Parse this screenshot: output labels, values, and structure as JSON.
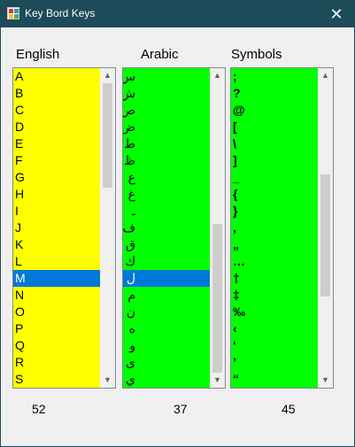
{
  "window": {
    "title": "Key Bord Keys",
    "close_glyph": "✕"
  },
  "english": {
    "header": "English",
    "items": [
      "A",
      "B",
      "C",
      "D",
      "E",
      "F",
      "G",
      "H",
      "I",
      "J",
      "K",
      "L",
      "M",
      "N",
      "O",
      "P",
      "Q",
      "R",
      "S"
    ],
    "selected": "M",
    "count": "52",
    "background": "#ffff00"
  },
  "arabic": {
    "header": "Arabic",
    "items": [
      "س",
      "ش",
      "ص",
      "ض",
      "ط",
      "ظ",
      "ع",
      "غ",
      "ـ",
      "ف",
      "ق",
      "ك",
      "ل",
      "م",
      "ن",
      "ه",
      "و",
      "ى",
      "ي"
    ],
    "selected": "ل",
    "count": "37",
    "background": "#00ff00"
  },
  "symbols": {
    "header": "Symbols",
    "items": [
      ";",
      "?",
      "@",
      "[",
      "\\",
      "]",
      "_",
      "{",
      "}",
      ",",
      "„",
      "…",
      "†",
      "‡",
      "‰",
      "‹",
      "‘",
      "’",
      "“"
    ],
    "count": "45",
    "background": "#00ff00"
  },
  "colors": {
    "titlebar": "#1d4b5a",
    "selection": "#0078d7"
  },
  "icons": {
    "app": "app-icon",
    "close": "close-icon",
    "scroll_up": "chevron-up-icon",
    "scroll_down": "chevron-down-icon"
  }
}
